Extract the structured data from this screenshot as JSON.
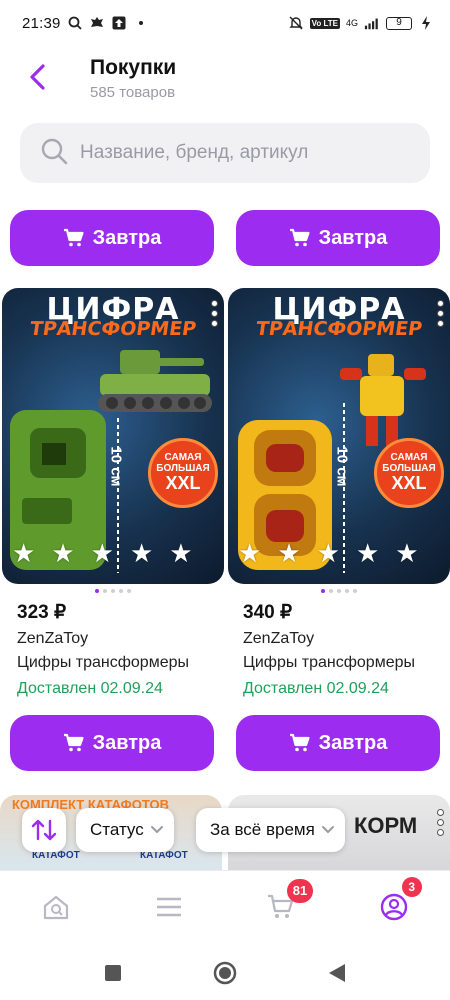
{
  "status_bar": {
    "time": "21:39",
    "network": "4G",
    "volte": "Vo LTE",
    "battery": "9"
  },
  "header": {
    "title": "Покупки",
    "subtitle": "585 товаров"
  },
  "search": {
    "placeholder": "Название, бренд, артикул"
  },
  "buy_label": "Завтра",
  "products": [
    {
      "image_title_1": "ЦИФРА",
      "image_title_2": "ТРАНСФОРМЕР",
      "image_badge_1": "САМАЯ",
      "image_badge_2": "БОЛЬШАЯ",
      "image_badge_3": "XXL",
      "image_size": "10 см",
      "price": "323 ₽",
      "brand": "ZenZaToy",
      "name": "Цифры трансформеры",
      "status": "Доставлен 02.09.24"
    },
    {
      "image_title_1": "ЦИФРА",
      "image_title_2": "ТРАНСФОРМЕР",
      "image_badge_1": "САМАЯ",
      "image_badge_2": "БОЛЬШАЯ",
      "image_badge_3": "XXL",
      "image_size": "10 см",
      "price": "340 ₽",
      "brand": "ZenZaToy",
      "name": "Цифры трансформеры",
      "status": "Доставлен 02.09.24"
    }
  ],
  "partial_products": [
    {
      "image_title": "КОМПЛЕКТ КАТАФОТОВ",
      "label_1": "КАТАФОТ",
      "label_2": "КАТАФОТ"
    },
    {
      "image_title": "КОРМ"
    }
  ],
  "filters": {
    "status_label": "Статус",
    "period_label": "За всё время"
  },
  "bottom_nav": {
    "cart_count": "81",
    "profile_count": "3"
  },
  "colors": {
    "accent": "#9b2cf0",
    "delivered": "#22a05a",
    "badge": "#f0334e"
  }
}
